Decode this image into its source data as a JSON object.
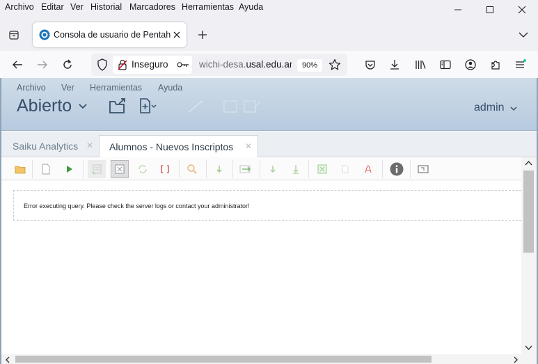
{
  "menubar": {
    "items": [
      "Archivo",
      "Editar",
      "Ver",
      "Historial",
      "Marcadores",
      "Herramientas",
      "Ayuda"
    ]
  },
  "tab": {
    "title": "Consola de usuario de Pentaho"
  },
  "urlbar": {
    "security_label": "Inseguro",
    "url_prefix": "wichi-desa.",
    "url_domain": "usal.edu.ar",
    "zoom": "90%"
  },
  "pentaho": {
    "menu": [
      "Archivo",
      "Ver",
      "Herramientas",
      "Ayuda"
    ],
    "perspective": "Abierto",
    "user": "admin"
  },
  "inner_tabs": [
    {
      "label": "Saiku Analytics"
    },
    {
      "label": "Alumnos - Nuevos Inscriptos"
    }
  ],
  "content": {
    "error_message": "Error executing query. Please check the server logs or contact your administrator!"
  },
  "colors": {
    "header_text": "#35506a",
    "saiku_green": "#3a9b3a",
    "pdf_red": "#e06666"
  }
}
